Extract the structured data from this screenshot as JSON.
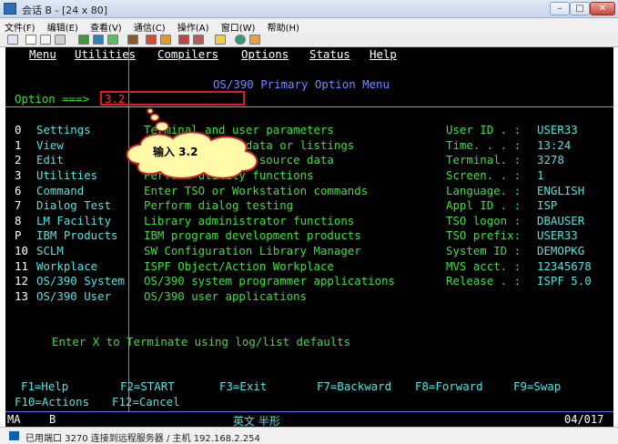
{
  "window": {
    "title": "会话 B - [24 x 80]",
    "min": "–",
    "max": "□",
    "close": "✕"
  },
  "menubar": [
    "文件(F)",
    "编辑(E)",
    "查看(V)",
    "通信(C)",
    "操作(A)",
    "窗口(W)",
    "帮助(H)"
  ],
  "terminal": {
    "action_bar": [
      "Menu",
      "Utilities",
      "Compilers",
      "Options",
      "Status",
      "Help"
    ],
    "panel_title": "OS/390 Primary Option Menu",
    "option_prompt": "Option ===>",
    "option_value": "3.2",
    "options": [
      {
        "num": "0",
        "name": "Settings",
        "desc": "Terminal and user parameters"
      },
      {
        "num": "1",
        "name": "View",
        "desc": "Display source data or listings"
      },
      {
        "num": "2",
        "name": "Edit",
        "desc": "Create or change source data"
      },
      {
        "num": "3",
        "name": "Utilities",
        "desc": "Perform utility functions"
      },
      {
        "num": "6",
        "name": "Command",
        "desc": "Enter TSO or Workstation commands"
      },
      {
        "num": "7",
        "name": "Dialog Test",
        "desc": "Perform dialog testing"
      },
      {
        "num": "8",
        "name": "LM Facility",
        "desc": "Library administrator functions"
      },
      {
        "num": "P",
        "name": "IBM Products",
        "desc": "IBM program development products"
      },
      {
        "num": "10",
        "name": "SCLM",
        "desc": "SW Configuration Library Manager"
      },
      {
        "num": "11",
        "name": "Workplace",
        "desc": "ISPF Object/Action Workplace"
      },
      {
        "num": "12",
        "name": "OS/390 System",
        "desc": "OS/390 system programmer applications"
      },
      {
        "num": "13",
        "name": "OS/390 User",
        "desc": "OS/390 user applications"
      }
    ],
    "info": [
      {
        "label": "User ID . :",
        "value": "USER33"
      },
      {
        "label": "Time. . . :",
        "value": "13:24"
      },
      {
        "label": "Terminal. :",
        "value": "3278"
      },
      {
        "label": "Screen. . :",
        "value": "1"
      },
      {
        "label": "Language. :",
        "value": "ENGLISH"
      },
      {
        "label": "Appl ID . :",
        "value": "ISP"
      },
      {
        "label": "TSO logon :",
        "value": "DBAUSER"
      },
      {
        "label": "TSO prefix:",
        "value": "USER33"
      },
      {
        "label": "System ID :",
        "value": "DEMOPKG"
      },
      {
        "label": "MVS acct. :",
        "value": "12345678"
      },
      {
        "label": "Release . :",
        "value": "ISPF 5.0"
      }
    ],
    "terminate_msg": "Enter X to Terminate using log/list defaults",
    "pf_row1": [
      "F1=Help",
      "F2=START",
      "F3=Exit",
      "F7=Backward",
      "F8=Forward",
      "F9=Swap"
    ],
    "pf_row2": [
      "F10=Actions",
      "F12=Cancel"
    ]
  },
  "annotation": {
    "text": "输入 3.2"
  },
  "oia": {
    "ma": "MA",
    "session": "B",
    "ime": "英文 半形",
    "cursor": "04/017"
  },
  "statusbar": {
    "text": "已用端口 3270 连接到远程服务器 / 主机 192.168.2.254"
  },
  "colors": {
    "terminal_bg": "#000000",
    "green": "#36e336",
    "cyan": "#4fe3e3",
    "highlight_box": "#e11b1b"
  }
}
